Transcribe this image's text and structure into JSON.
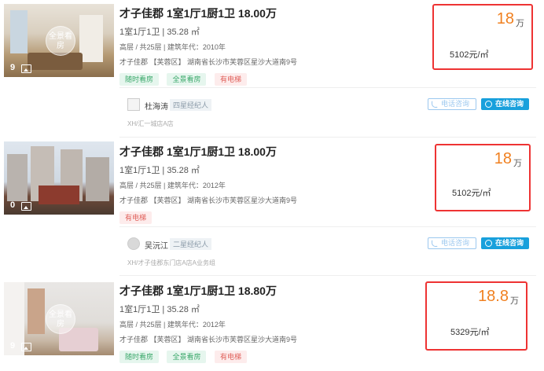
{
  "listings": [
    {
      "photo_count": "9",
      "pano_label": "全景看房",
      "title": "才子佳郡 1室1厅1厨1卫 18.00万",
      "sub": "1室1厅1卫 | 35.28 ㎡",
      "meta": "高层 / 共25层 | 建筑年代：2010年",
      "addr": "才子佳郡 【芙蓉区】 湖南省长沙市芙蓉区星沙大道南9号",
      "tags": [
        "随时看房",
        "全景看房",
        "有电梯"
      ],
      "price_total": "18",
      "price_unit_label": "万",
      "price_per": "5102元/㎡",
      "agent": {
        "name": "杜海涛",
        "badge": "四星经纪人",
        "shop": "XH/汇一城店A店",
        "phone_label": "电话咨询",
        "chat_label": "在线咨询"
      }
    },
    {
      "photo_count": "0",
      "pano_label": "",
      "title": "才子佳郡 1室1厅1厨1卫 18.00万",
      "sub": "1室1厅1卫 | 35.28 ㎡",
      "meta": "高层 / 共25层 | 建筑年代：2012年",
      "addr": "才子佳郡 【芙蓉区】 湖南省长沙市芙蓉区星沙大道南9号",
      "tags": [
        "有电梯"
      ],
      "price_total": "18",
      "price_unit_label": "万",
      "price_per": "5102元/㎡",
      "agent": {
        "name": "吴沅江",
        "badge": "二星经纪人",
        "shop": "XH/才子佳郡东门店A店A业务组",
        "phone_label": "电话咨询",
        "chat_label": "在线咨询"
      }
    },
    {
      "photo_count": "9",
      "pano_label": "全景看房",
      "title": "才子佳郡 1室1厅1厨1卫 18.80万",
      "sub": "1室1厅1卫 | 35.28 ㎡",
      "meta": "高层 / 共25层 | 建筑年代：2012年",
      "addr": "才子佳郡 【芙蓉区】 湖南省长沙市芙蓉区星沙大道南9号",
      "tags": [
        "随时看房",
        "全景看房",
        "有电梯"
      ],
      "price_total": "18.8",
      "price_unit_label": "万",
      "price_per": "5329元/㎡"
    }
  ],
  "colors": {
    "price": "#f08020",
    "highlight_border": "#e33",
    "tag_green": "#3aa86a",
    "tag_red": "#e0605a",
    "chat_button": "#18a0dc"
  }
}
